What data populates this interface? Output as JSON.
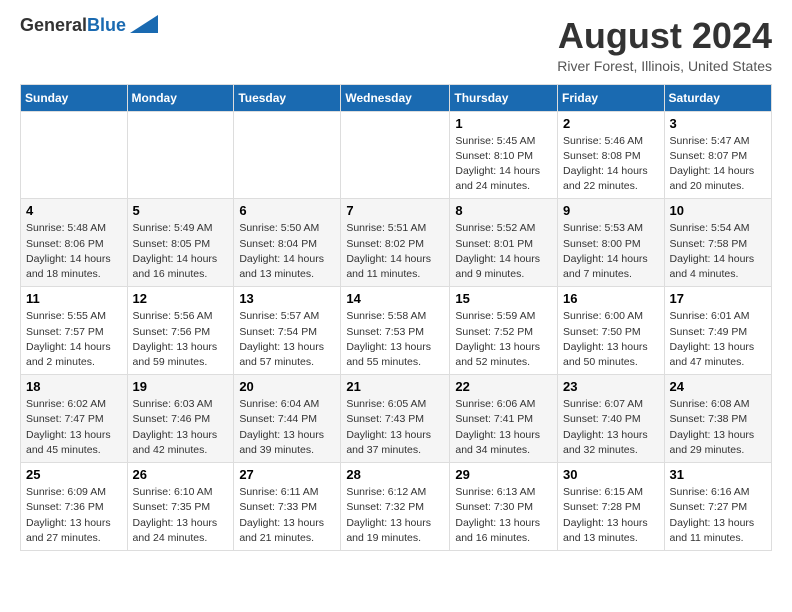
{
  "logo": {
    "line1": "General",
    "line2": "Blue"
  },
  "title": "August 2024",
  "subtitle": "River Forest, Illinois, United States",
  "days_of_week": [
    "Sunday",
    "Monday",
    "Tuesday",
    "Wednesday",
    "Thursday",
    "Friday",
    "Saturday"
  ],
  "weeks": [
    [
      {
        "day": "",
        "info": ""
      },
      {
        "day": "",
        "info": ""
      },
      {
        "day": "",
        "info": ""
      },
      {
        "day": "",
        "info": ""
      },
      {
        "day": "1",
        "info": "Sunrise: 5:45 AM\nSunset: 8:10 PM\nDaylight: 14 hours\nand 24 minutes."
      },
      {
        "day": "2",
        "info": "Sunrise: 5:46 AM\nSunset: 8:08 PM\nDaylight: 14 hours\nand 22 minutes."
      },
      {
        "day": "3",
        "info": "Sunrise: 5:47 AM\nSunset: 8:07 PM\nDaylight: 14 hours\nand 20 minutes."
      }
    ],
    [
      {
        "day": "4",
        "info": "Sunrise: 5:48 AM\nSunset: 8:06 PM\nDaylight: 14 hours\nand 18 minutes."
      },
      {
        "day": "5",
        "info": "Sunrise: 5:49 AM\nSunset: 8:05 PM\nDaylight: 14 hours\nand 16 minutes."
      },
      {
        "day": "6",
        "info": "Sunrise: 5:50 AM\nSunset: 8:04 PM\nDaylight: 14 hours\nand 13 minutes."
      },
      {
        "day": "7",
        "info": "Sunrise: 5:51 AM\nSunset: 8:02 PM\nDaylight: 14 hours\nand 11 minutes."
      },
      {
        "day": "8",
        "info": "Sunrise: 5:52 AM\nSunset: 8:01 PM\nDaylight: 14 hours\nand 9 minutes."
      },
      {
        "day": "9",
        "info": "Sunrise: 5:53 AM\nSunset: 8:00 PM\nDaylight: 14 hours\nand 7 minutes."
      },
      {
        "day": "10",
        "info": "Sunrise: 5:54 AM\nSunset: 7:58 PM\nDaylight: 14 hours\nand 4 minutes."
      }
    ],
    [
      {
        "day": "11",
        "info": "Sunrise: 5:55 AM\nSunset: 7:57 PM\nDaylight: 14 hours\nand 2 minutes."
      },
      {
        "day": "12",
        "info": "Sunrise: 5:56 AM\nSunset: 7:56 PM\nDaylight: 13 hours\nand 59 minutes."
      },
      {
        "day": "13",
        "info": "Sunrise: 5:57 AM\nSunset: 7:54 PM\nDaylight: 13 hours\nand 57 minutes."
      },
      {
        "day": "14",
        "info": "Sunrise: 5:58 AM\nSunset: 7:53 PM\nDaylight: 13 hours\nand 55 minutes."
      },
      {
        "day": "15",
        "info": "Sunrise: 5:59 AM\nSunset: 7:52 PM\nDaylight: 13 hours\nand 52 minutes."
      },
      {
        "day": "16",
        "info": "Sunrise: 6:00 AM\nSunset: 7:50 PM\nDaylight: 13 hours\nand 50 minutes."
      },
      {
        "day": "17",
        "info": "Sunrise: 6:01 AM\nSunset: 7:49 PM\nDaylight: 13 hours\nand 47 minutes."
      }
    ],
    [
      {
        "day": "18",
        "info": "Sunrise: 6:02 AM\nSunset: 7:47 PM\nDaylight: 13 hours\nand 45 minutes."
      },
      {
        "day": "19",
        "info": "Sunrise: 6:03 AM\nSunset: 7:46 PM\nDaylight: 13 hours\nand 42 minutes."
      },
      {
        "day": "20",
        "info": "Sunrise: 6:04 AM\nSunset: 7:44 PM\nDaylight: 13 hours\nand 39 minutes."
      },
      {
        "day": "21",
        "info": "Sunrise: 6:05 AM\nSunset: 7:43 PM\nDaylight: 13 hours\nand 37 minutes."
      },
      {
        "day": "22",
        "info": "Sunrise: 6:06 AM\nSunset: 7:41 PM\nDaylight: 13 hours\nand 34 minutes."
      },
      {
        "day": "23",
        "info": "Sunrise: 6:07 AM\nSunset: 7:40 PM\nDaylight: 13 hours\nand 32 minutes."
      },
      {
        "day": "24",
        "info": "Sunrise: 6:08 AM\nSunset: 7:38 PM\nDaylight: 13 hours\nand 29 minutes."
      }
    ],
    [
      {
        "day": "25",
        "info": "Sunrise: 6:09 AM\nSunset: 7:36 PM\nDaylight: 13 hours\nand 27 minutes."
      },
      {
        "day": "26",
        "info": "Sunrise: 6:10 AM\nSunset: 7:35 PM\nDaylight: 13 hours\nand 24 minutes."
      },
      {
        "day": "27",
        "info": "Sunrise: 6:11 AM\nSunset: 7:33 PM\nDaylight: 13 hours\nand 21 minutes."
      },
      {
        "day": "28",
        "info": "Sunrise: 6:12 AM\nSunset: 7:32 PM\nDaylight: 13 hours\nand 19 minutes."
      },
      {
        "day": "29",
        "info": "Sunrise: 6:13 AM\nSunset: 7:30 PM\nDaylight: 13 hours\nand 16 minutes."
      },
      {
        "day": "30",
        "info": "Sunrise: 6:15 AM\nSunset: 7:28 PM\nDaylight: 13 hours\nand 13 minutes."
      },
      {
        "day": "31",
        "info": "Sunrise: 6:16 AM\nSunset: 7:27 PM\nDaylight: 13 hours\nand 11 minutes."
      }
    ]
  ]
}
